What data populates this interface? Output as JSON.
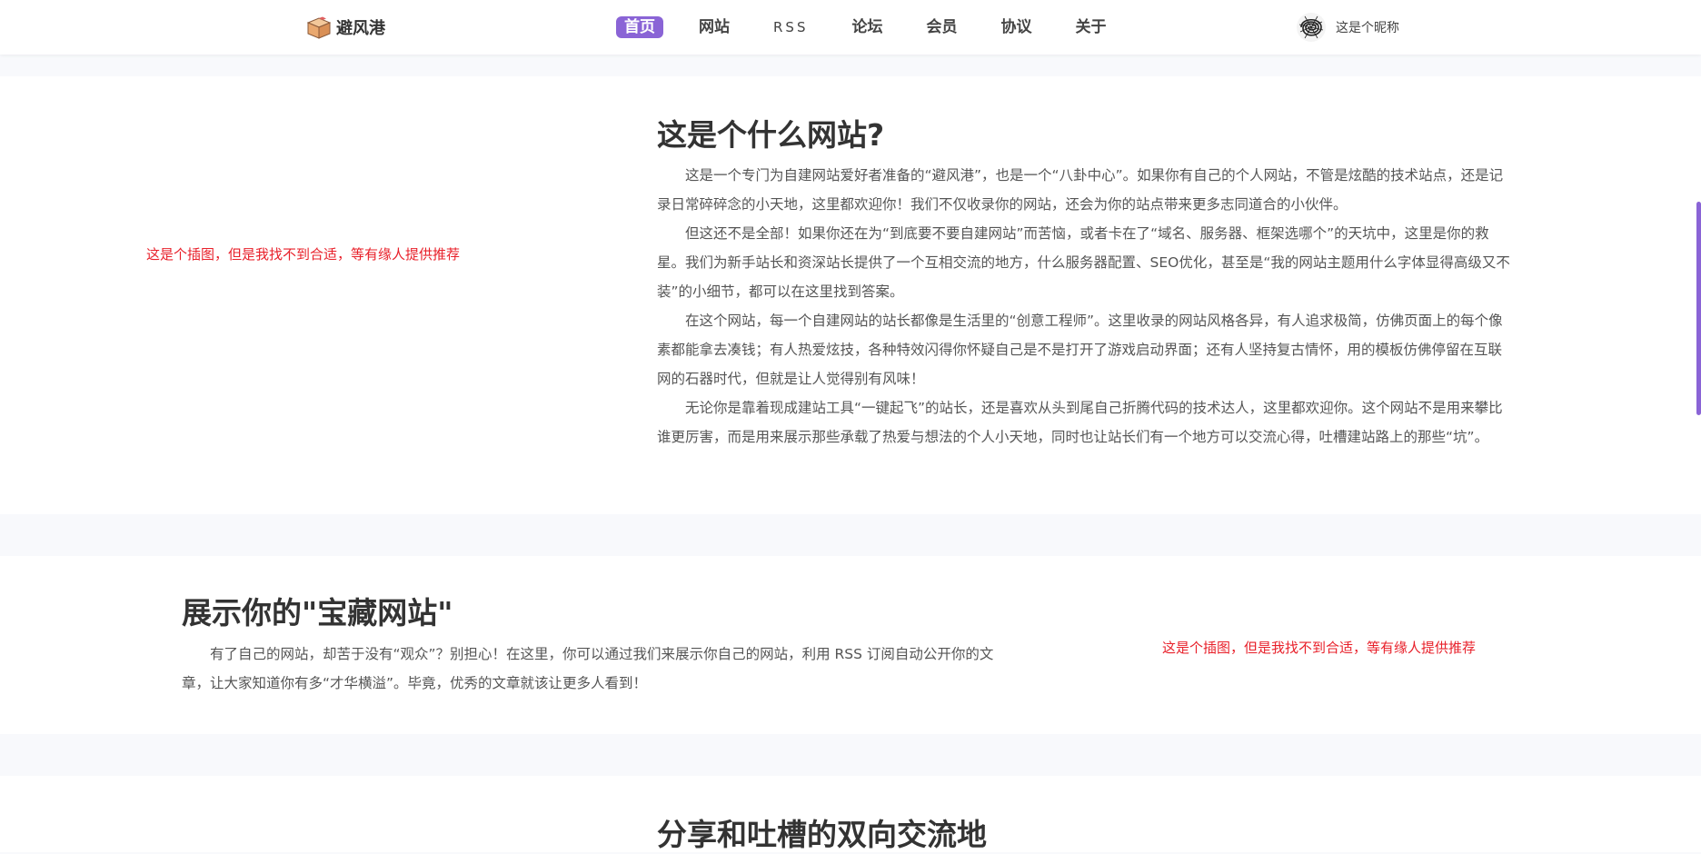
{
  "header": {
    "brand": {
      "name": "避风港",
      "icon": "package-box-icon"
    },
    "nav": [
      {
        "label": "首页",
        "active": true
      },
      {
        "label": "网站",
        "active": false
      },
      {
        "label": "RSS",
        "active": false
      },
      {
        "label": "论坛",
        "active": false
      },
      {
        "label": "会员",
        "active": false
      },
      {
        "label": "协议",
        "active": false
      },
      {
        "label": "关于",
        "active": false
      }
    ],
    "user": {
      "name": "这是个昵称",
      "avatar_icon": "scribble-avatar-icon"
    }
  },
  "section1": {
    "illustration_placeholder": "这是个插图，但是我找不到合适，等有缘人提供推荐",
    "title": "这是个什么网站?",
    "paragraphs": [
      "这是一个专门为自建网站爱好者准备的“避风港”，也是一个“八卦中心”。如果你有自己的个人网站，不管是炫酷的技术站点，还是记录日常碎碎念的小天地，这里都欢迎你！我们不仅收录你的网站，还会为你的站点带来更多志同道合的小伙伴。",
      "但这还不是全部！如果你还在为“到底要不要自建网站”而苦恼，或者卡在了“域名、服务器、框架选哪个”的天坑中，这里是你的救星。我们为新手站长和资深站长提供了一个互相交流的地方，什么服务器配置、SEO优化，甚至是“我的网站主题用什么字体显得高级又不装”的小细节，都可以在这里找到答案。",
      "在这个网站，每一个自建网站的站长都像是生活里的“创意工程师”。这里收录的网站风格各异，有人追求极简，仿佛页面上的每个像素都能拿去凑钱；有人热爱炫技，各种特效闪得你怀疑自己是不是打开了游戏启动界面；还有人坚持复古情怀，用的模板仿佛停留在互联网的石器时代，但就是让人觉得别有风味！",
      "无论你是靠着现成建站工具“一键起飞”的站长，还是喜欢从头到尾自己折腾代码的技术达人，这里都欢迎你。这个网站不是用来攀比谁更厉害，而是用来展示那些承载了热爱与想法的个人小天地，同时也让站长们有一个地方可以交流心得，吐槽建站路上的那些“坑”。"
    ]
  },
  "section2": {
    "title": "展示你的\"宝藏网站\"",
    "paragraph": "有了自己的网站，却苦于没有“观众”？别担心！在这里，你可以通过我们来展示你自己的网站，利用 RSS 订阅自动公开你的文章，让大家知道你有多“才华横溢”。毕竟，优秀的文章就该让更多人看到！",
    "illustration_placeholder": "这是个插图，但是我找不到合适，等有缘人提供推荐"
  },
  "section3": {
    "title": "分享和吐槽的双向交流地"
  },
  "colors": {
    "accent": "#8a64d6",
    "placeholder_red": "#e8202a",
    "page_bg": "#f8f9fc",
    "card_bg": "#ffffff"
  }
}
